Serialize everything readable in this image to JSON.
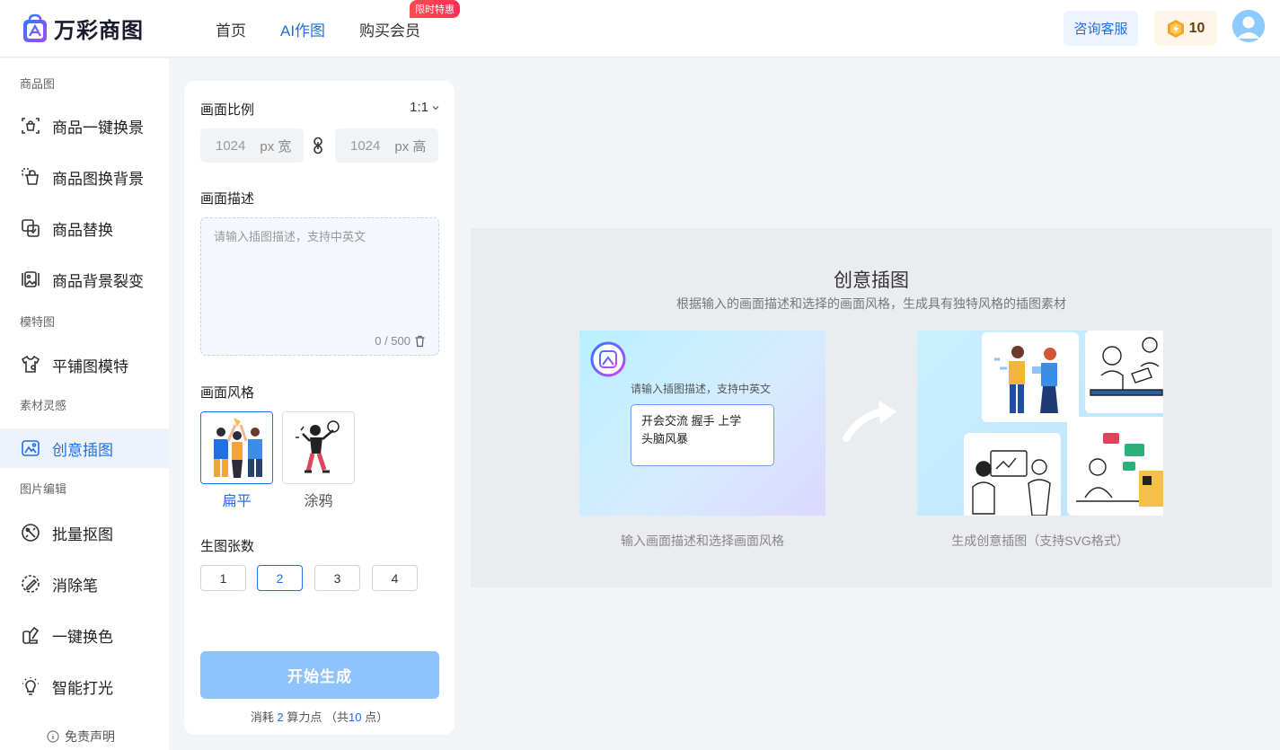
{
  "header": {
    "brand": "万彩商图",
    "nav": [
      {
        "label": "首页"
      },
      {
        "label": "AI作图"
      },
      {
        "label": "购买会员",
        "badge": "限时特惠"
      }
    ],
    "consult_label": "咨询客服",
    "points": "10"
  },
  "sidebar": {
    "sections": [
      {
        "title": "商品图",
        "items": [
          "商品一键换景",
          "商品图换背景",
          "商品替换",
          "商品背景裂变"
        ]
      },
      {
        "title": "模特图",
        "items": [
          "平铺图模特"
        ]
      },
      {
        "title": "素材灵感",
        "items": [
          "创意插图"
        ]
      },
      {
        "title": "图片编辑",
        "items": [
          "批量抠图",
          "消除笔",
          "一键换色",
          "智能打光"
        ]
      }
    ],
    "disclaimer": "免责声明"
  },
  "form": {
    "ratio_label": "画面比例",
    "ratio_value": "1:1",
    "width_value": "1024",
    "width_unit": "px 宽",
    "height_value": "1024",
    "height_unit": "px 高",
    "desc_label": "画面描述",
    "desc_placeholder": "请输入插图描述，支持中英文",
    "desc_count": "0 / 500",
    "style_label": "画面风格",
    "styles": [
      "扁平",
      "涂鸦"
    ],
    "count_label": "生图张数",
    "counts": [
      "1",
      "2",
      "3",
      "4"
    ],
    "generate_label": "开始生成",
    "cost_prefix": "消耗",
    "cost_value": "2",
    "cost_mid": "算力点 （共",
    "cost_total": "10",
    "cost_suffix": "点）"
  },
  "preview": {
    "title": "创意插图",
    "subtitle": "根据输入的画面描述和选择的画面风格，生成具有独特风格的插图素材",
    "input_hint": "请输入插图描述，支持中英文",
    "input_line1": "开会交流  握手  上学",
    "input_line2": "头脑风暴",
    "caption_left": "输入画面描述和选择画面风格",
    "caption_right": "生成创意插图（支持SVG格式）"
  },
  "colors": {
    "accent": "#1f6fe5",
    "generate_disabled": "#8fc3fb",
    "badge": "#ff3b4a"
  }
}
